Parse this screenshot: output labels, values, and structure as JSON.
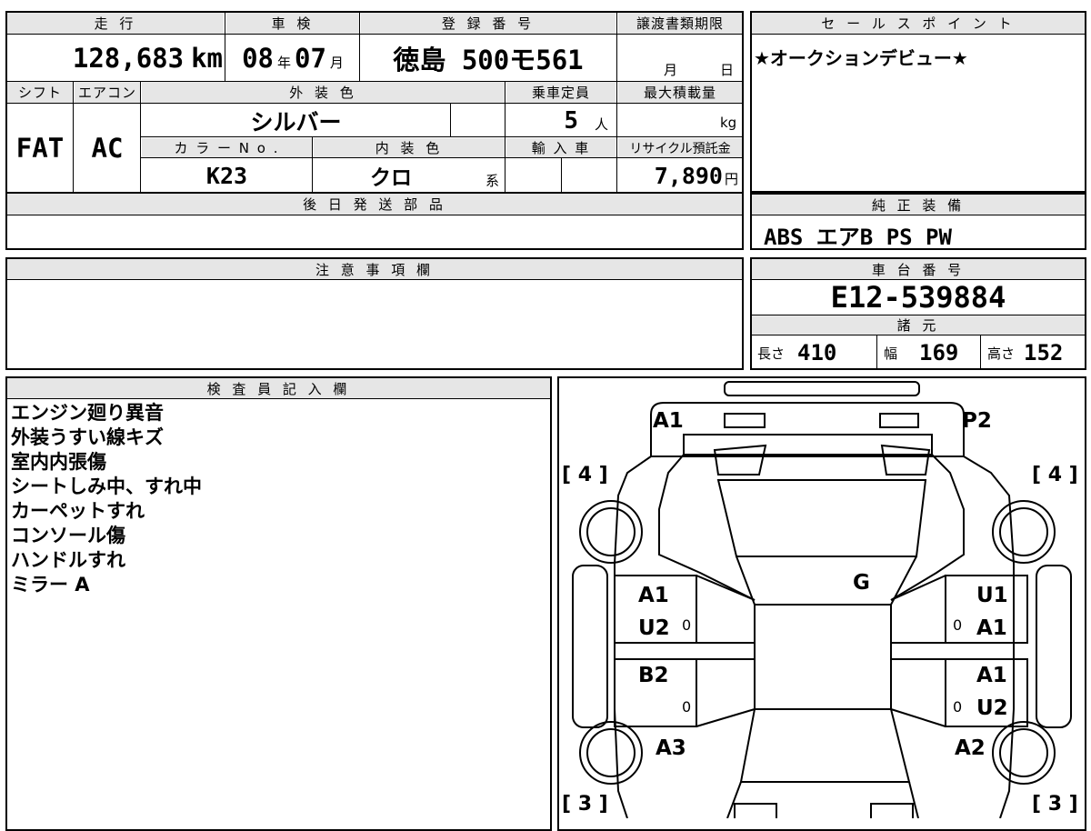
{
  "vehicle": {
    "headers": {
      "mileage": "走 行",
      "inspection": "車 検",
      "registration": "登 録 番 号",
      "transfer_deadline": "譲渡書類期限",
      "shift": "シフト",
      "aircon": "エアコン",
      "exterior_color": "外 装 色",
      "capacity": "乗車定員",
      "max_load": "最大積載量",
      "color_no": "カ ラ ー N o .",
      "interior_color": "内 装 色",
      "imported": "輸 入 車",
      "recycle_fee": "リサイクル預託金",
      "later_parts": "後 日 発 送 部 品"
    },
    "mileage_value": "128,683",
    "mileage_unit": "km",
    "inspection_year": "08",
    "inspection_year_unit": "年",
    "inspection_month": "07",
    "inspection_month_unit": "月",
    "registration_number": "徳島 500モ561",
    "deadline_month_unit": "月",
    "deadline_day_unit": "日",
    "shift_value": "FAT",
    "aircon_value": "AC",
    "exterior_color_value": "シルバー",
    "capacity_value": "5",
    "capacity_unit": "人",
    "max_load_unit": "kg",
    "color_no_value": "K23",
    "interior_color_value": "クロ",
    "interior_color_suffix": "系",
    "recycle_fee_value": "7,890",
    "recycle_fee_unit": "円"
  },
  "sales_point": {
    "header": "セ ー ル ス ポ イ ン ト",
    "text": "★オークションデビュー★"
  },
  "genuine_equipment": {
    "header": "純 正 装 備",
    "text": "ABS エアB PS PW"
  },
  "notes": {
    "header": "注 意 事 項 欄"
  },
  "chassis": {
    "header": "車 台 番 号",
    "number": "E12-539884",
    "spec_header": "諸 元",
    "length_label": "長さ",
    "length_value": "410",
    "width_label": "幅",
    "width_value": "169",
    "height_label": "高さ",
    "height_value": "152"
  },
  "inspector": {
    "header": "検 査 員 記 入 欄",
    "lines": [
      "エンジン廻り異音",
      "外装うすい線キズ",
      "室内内張傷",
      "シートしみ中、すれ中",
      "カーペットすれ",
      "コンソール傷",
      "ハンドルすれ",
      "ミラー A"
    ]
  },
  "diagram": {
    "front_left": "A1",
    "front_right": "P2",
    "bracket_tl": "[ 4 ]",
    "bracket_tr": "[ 4 ]",
    "bracket_bl": "[ 3 ]",
    "bracket_br": "[ 3 ]",
    "glass": "G",
    "lf_door_top": "A1",
    "lf_door_bot": "U2",
    "lr_door_top": "B2",
    "rf_door_top": "U1",
    "rf_door_bot": "A1",
    "rr_door_top": "A1",
    "rr_door_bot": "U2",
    "rear_left": "A3",
    "rear_right": "A2",
    "zero_mark": "0"
  }
}
